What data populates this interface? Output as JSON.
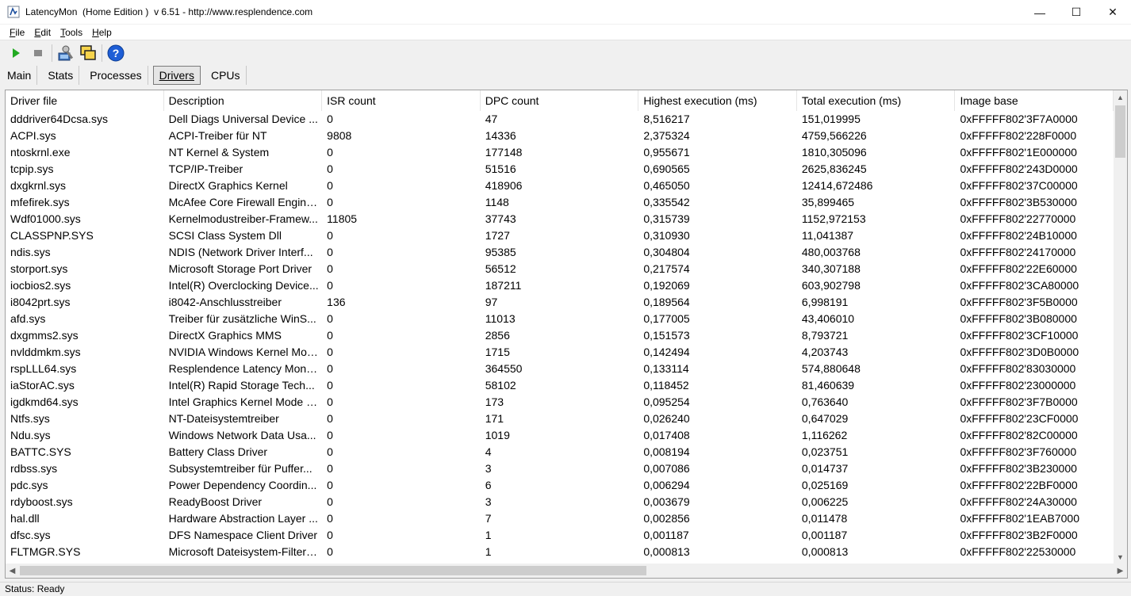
{
  "window": {
    "title": "LatencyMon  (Home Edition )  v 6.51 - http://www.resplendence.com",
    "minimize_glyph": "—",
    "maximize_glyph": "☐",
    "close_glyph": "✕"
  },
  "menu": {
    "items": [
      {
        "key": "F",
        "rest": "ile"
      },
      {
        "key": "E",
        "rest": "dit"
      },
      {
        "key": "T",
        "rest": "ools"
      },
      {
        "key": "H",
        "rest": "elp"
      }
    ]
  },
  "toolbar": {
    "icons": [
      "play-icon",
      "stop-icon",
      "settings-icon",
      "window-icon",
      "help-icon"
    ],
    "colors": {
      "play": "#22aa22",
      "stop": "#8a8a8a",
      "help": "#1e5ed6"
    }
  },
  "tabs": [
    {
      "label": "Main",
      "active": false
    },
    {
      "label": "Stats",
      "active": false
    },
    {
      "label": "Processes",
      "active": false
    },
    {
      "label": "Drivers",
      "active": true
    },
    {
      "label": "CPUs",
      "active": false
    }
  ],
  "table": {
    "columns": [
      "Driver file",
      "Description",
      "ISR count",
      "DPC count",
      "Highest execution (ms)",
      "Total execution (ms)",
      "Image base"
    ],
    "rows": [
      [
        "dddriver64Dcsa.sys",
        "Dell Diags Universal Device ...",
        "0",
        "47",
        "8,516217",
        "151,019995",
        "0xFFFFF802'3F7A0000"
      ],
      [
        "ACPI.sys",
        "ACPI-Treiber für NT",
        "9808",
        "14336",
        "2,375324",
        "4759,566226",
        "0xFFFFF802'228F0000"
      ],
      [
        "ntoskrnl.exe",
        "NT Kernel & System",
        "0",
        "177148",
        "0,955671",
        "1810,305096",
        "0xFFFFF802'1E000000"
      ],
      [
        "tcpip.sys",
        "TCP/IP-Treiber",
        "0",
        "51516",
        "0,690565",
        "2625,836245",
        "0xFFFFF802'243D0000"
      ],
      [
        "dxgkrnl.sys",
        "DirectX Graphics Kernel",
        "0",
        "418906",
        "0,465050",
        "12414,672486",
        "0xFFFFF802'37C00000"
      ],
      [
        "mfefirek.sys",
        "McAfee Core Firewall Engine ...",
        "0",
        "1148",
        "0,335542",
        "35,899465",
        "0xFFFFF802'3B530000"
      ],
      [
        "Wdf01000.sys",
        "Kernelmodustreiber-Framew...",
        "11805",
        "37743",
        "0,315739",
        "1152,972153",
        "0xFFFFF802'22770000"
      ],
      [
        "CLASSPNP.SYS",
        "SCSI Class System Dll",
        "0",
        "1727",
        "0,310930",
        "11,041387",
        "0xFFFFF802'24B10000"
      ],
      [
        "ndis.sys",
        "NDIS (Network Driver Interf...",
        "0",
        "95385",
        "0,304804",
        "480,003768",
        "0xFFFFF802'24170000"
      ],
      [
        "storport.sys",
        "Microsoft Storage Port Driver",
        "0",
        "56512",
        "0,217574",
        "340,307188",
        "0xFFFFF802'22E60000"
      ],
      [
        "iocbios2.sys",
        "Intel(R) Overclocking Device...",
        "0",
        "187211",
        "0,192069",
        "603,902798",
        "0xFFFFF802'3CA80000"
      ],
      [
        "i8042prt.sys",
        "i8042-Anschlusstreiber",
        "136",
        "97",
        "0,189564",
        "6,998191",
        "0xFFFFF802'3F5B0000"
      ],
      [
        "afd.sys",
        "Treiber für zusätzliche WinS...",
        "0",
        "11013",
        "0,177005",
        "43,406010",
        "0xFFFFF802'3B080000"
      ],
      [
        "dxgmms2.sys",
        "DirectX Graphics MMS",
        "0",
        "2856",
        "0,151573",
        "8,793721",
        "0xFFFFF802'3CF10000"
      ],
      [
        "nvlddmkm.sys",
        "NVIDIA Windows Kernel Mod...",
        "0",
        "1715",
        "0,142494",
        "4,203743",
        "0xFFFFF802'3D0B0000"
      ],
      [
        "rspLLL64.sys",
        "Resplendence Latency Monit...",
        "0",
        "364550",
        "0,133114",
        "574,880648",
        "0xFFFFF802'83030000"
      ],
      [
        "iaStorAC.sys",
        "Intel(R) Rapid Storage Tech...",
        "0",
        "58102",
        "0,118452",
        "81,460639",
        "0xFFFFF802'23000000"
      ],
      [
        "igdkmd64.sys",
        "Intel Graphics Kernel Mode D...",
        "0",
        "173",
        "0,095254",
        "0,763640",
        "0xFFFFF802'3F7B0000"
      ],
      [
        "Ntfs.sys",
        "NT-Dateisystemtreiber",
        "0",
        "171",
        "0,026240",
        "0,647029",
        "0xFFFFF802'23CF0000"
      ],
      [
        "Ndu.sys",
        "Windows Network Data Usa...",
        "0",
        "1019",
        "0,017408",
        "1,116262",
        "0xFFFFF802'82C00000"
      ],
      [
        "BATTC.SYS",
        "Battery Class Driver",
        "0",
        "4",
        "0,008194",
        "0,023751",
        "0xFFFFF802'3F760000"
      ],
      [
        "rdbss.sys",
        "Subsystemtreiber für Puffer...",
        "0",
        "3",
        "0,007086",
        "0,014737",
        "0xFFFFF802'3B230000"
      ],
      [
        "pdc.sys",
        "Power Dependency Coordin...",
        "0",
        "6",
        "0,006294",
        "0,025169",
        "0xFFFFF802'22BF0000"
      ],
      [
        "rdyboost.sys",
        "ReadyBoost Driver",
        "0",
        "3",
        "0,003679",
        "0,006225",
        "0xFFFFF802'24A30000"
      ],
      [
        "hal.dll",
        "Hardware Abstraction Layer ...",
        "0",
        "7",
        "0,002856",
        "0,011478",
        "0xFFFFF802'1EAB7000"
      ],
      [
        "dfsc.sys",
        "DFS Namespace Client Driver",
        "0",
        "1",
        "0,001187",
        "0,001187",
        "0xFFFFF802'3B2F0000"
      ],
      [
        "FLTMGR.SYS",
        "Microsoft Dateisystem-Filter-...",
        "0",
        "1",
        "0,000813",
        "0,000813",
        "0xFFFFF802'22530000"
      ]
    ]
  },
  "scroll": {
    "up": "▲",
    "down": "▼",
    "left": "◀",
    "right": "▶"
  },
  "status": {
    "text": "Status: Ready"
  }
}
